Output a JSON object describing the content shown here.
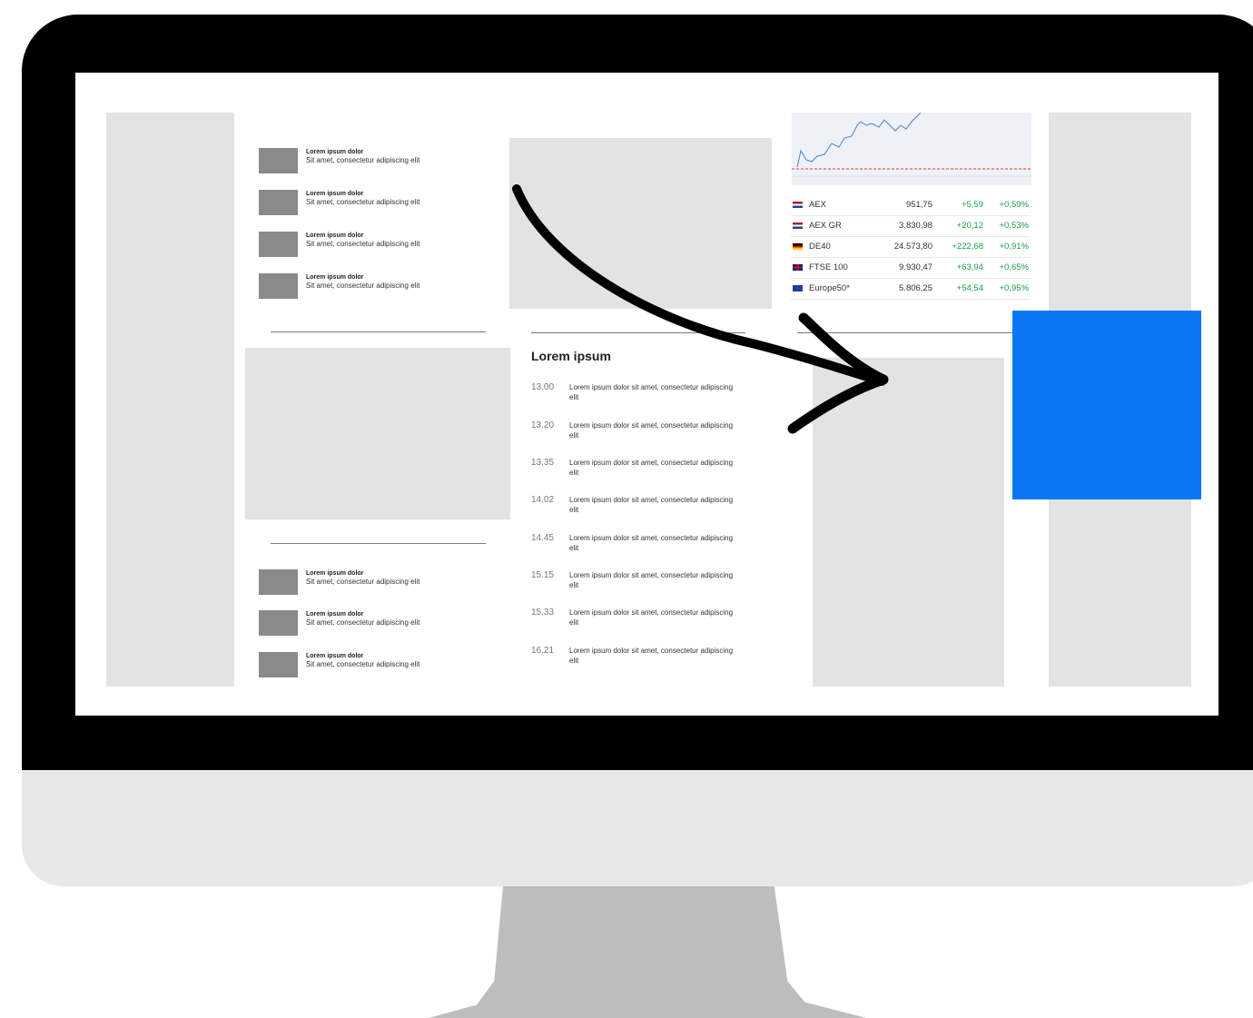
{
  "teasers_top": [
    {
      "title": "Lorem ipsum dolor",
      "subtitle": "Sit amet, consectetur adipiscing elit"
    },
    {
      "title": "Lorem ipsum dolor",
      "subtitle": "Sit amet, consectetur adipiscing elit"
    },
    {
      "title": "Lorem ipsum dolor",
      "subtitle": "Sit amet, consectetur adipiscing elit"
    },
    {
      "title": "Lorem ipsum dolor",
      "subtitle": "Sit amet, consectetur adipiscing elit"
    }
  ],
  "teasers_bottom": [
    {
      "title": "Lorem ipsum dolor",
      "subtitle": "Sit amet, consectetur adipiscing elit"
    },
    {
      "title": "Lorem ipsum dolor",
      "subtitle": "Sit amet, consectetur adipiscing elit"
    },
    {
      "title": "Lorem ipsum dolor",
      "subtitle": "Sit amet, consectetur adipiscing elit"
    }
  ],
  "timeline": {
    "title": "Lorem ipsum",
    "items": [
      {
        "time": "13.00",
        "text": "Lorem ipsum dolor sit amet, consectetur adipiscing elit"
      },
      {
        "time": "13.20",
        "text": "Lorem ipsum dolor sit amet, consectetur adipiscing elit"
      },
      {
        "time": "13.35",
        "text": "Lorem ipsum dolor sit amet, consectetur adipiscing elit"
      },
      {
        "time": "14.02",
        "text": "Lorem ipsum dolor sit amet, consectetur adipiscing elit"
      },
      {
        "time": "14.45",
        "text": "Lorem ipsum dolor sit amet, consectetur adipiscing elit"
      },
      {
        "time": "15.15",
        "text": "Lorem ipsum dolor sit amet, consectetur adipiscing elit"
      },
      {
        "time": "15.33",
        "text": "Lorem ipsum dolor sit amet, consectetur adipiscing elit"
      },
      {
        "time": "16.21",
        "text": "Lorem ipsum dolor sit amet, consectetur adipiscing elit"
      }
    ]
  },
  "quotes": [
    {
      "name": "AEX",
      "value": "951,75",
      "change": "+5,59",
      "percent": "+0,59%",
      "flag": "nl"
    },
    {
      "name": "AEX GR",
      "value": "3.830,98",
      "change": "+20,12",
      "percent": "+0,53%",
      "flag": "nl"
    },
    {
      "name": "DE40",
      "value": "24.573,80",
      "change": "+222,68",
      "percent": "+0,91%",
      "flag": "de"
    },
    {
      "name": "FTSE 100",
      "value": "9.930,47",
      "change": "+63,94",
      "percent": "+0,65%",
      "flag": "uk"
    },
    {
      "name": "Europe50*",
      "value": "5.806,25",
      "change": "+54,54",
      "percent": "+0,95%",
      "flag": "eu"
    }
  ],
  "colors": {
    "accent_blue": "#0a78f5",
    "positive": "#1aa04a",
    "placeholder": "#e3e3e3"
  }
}
